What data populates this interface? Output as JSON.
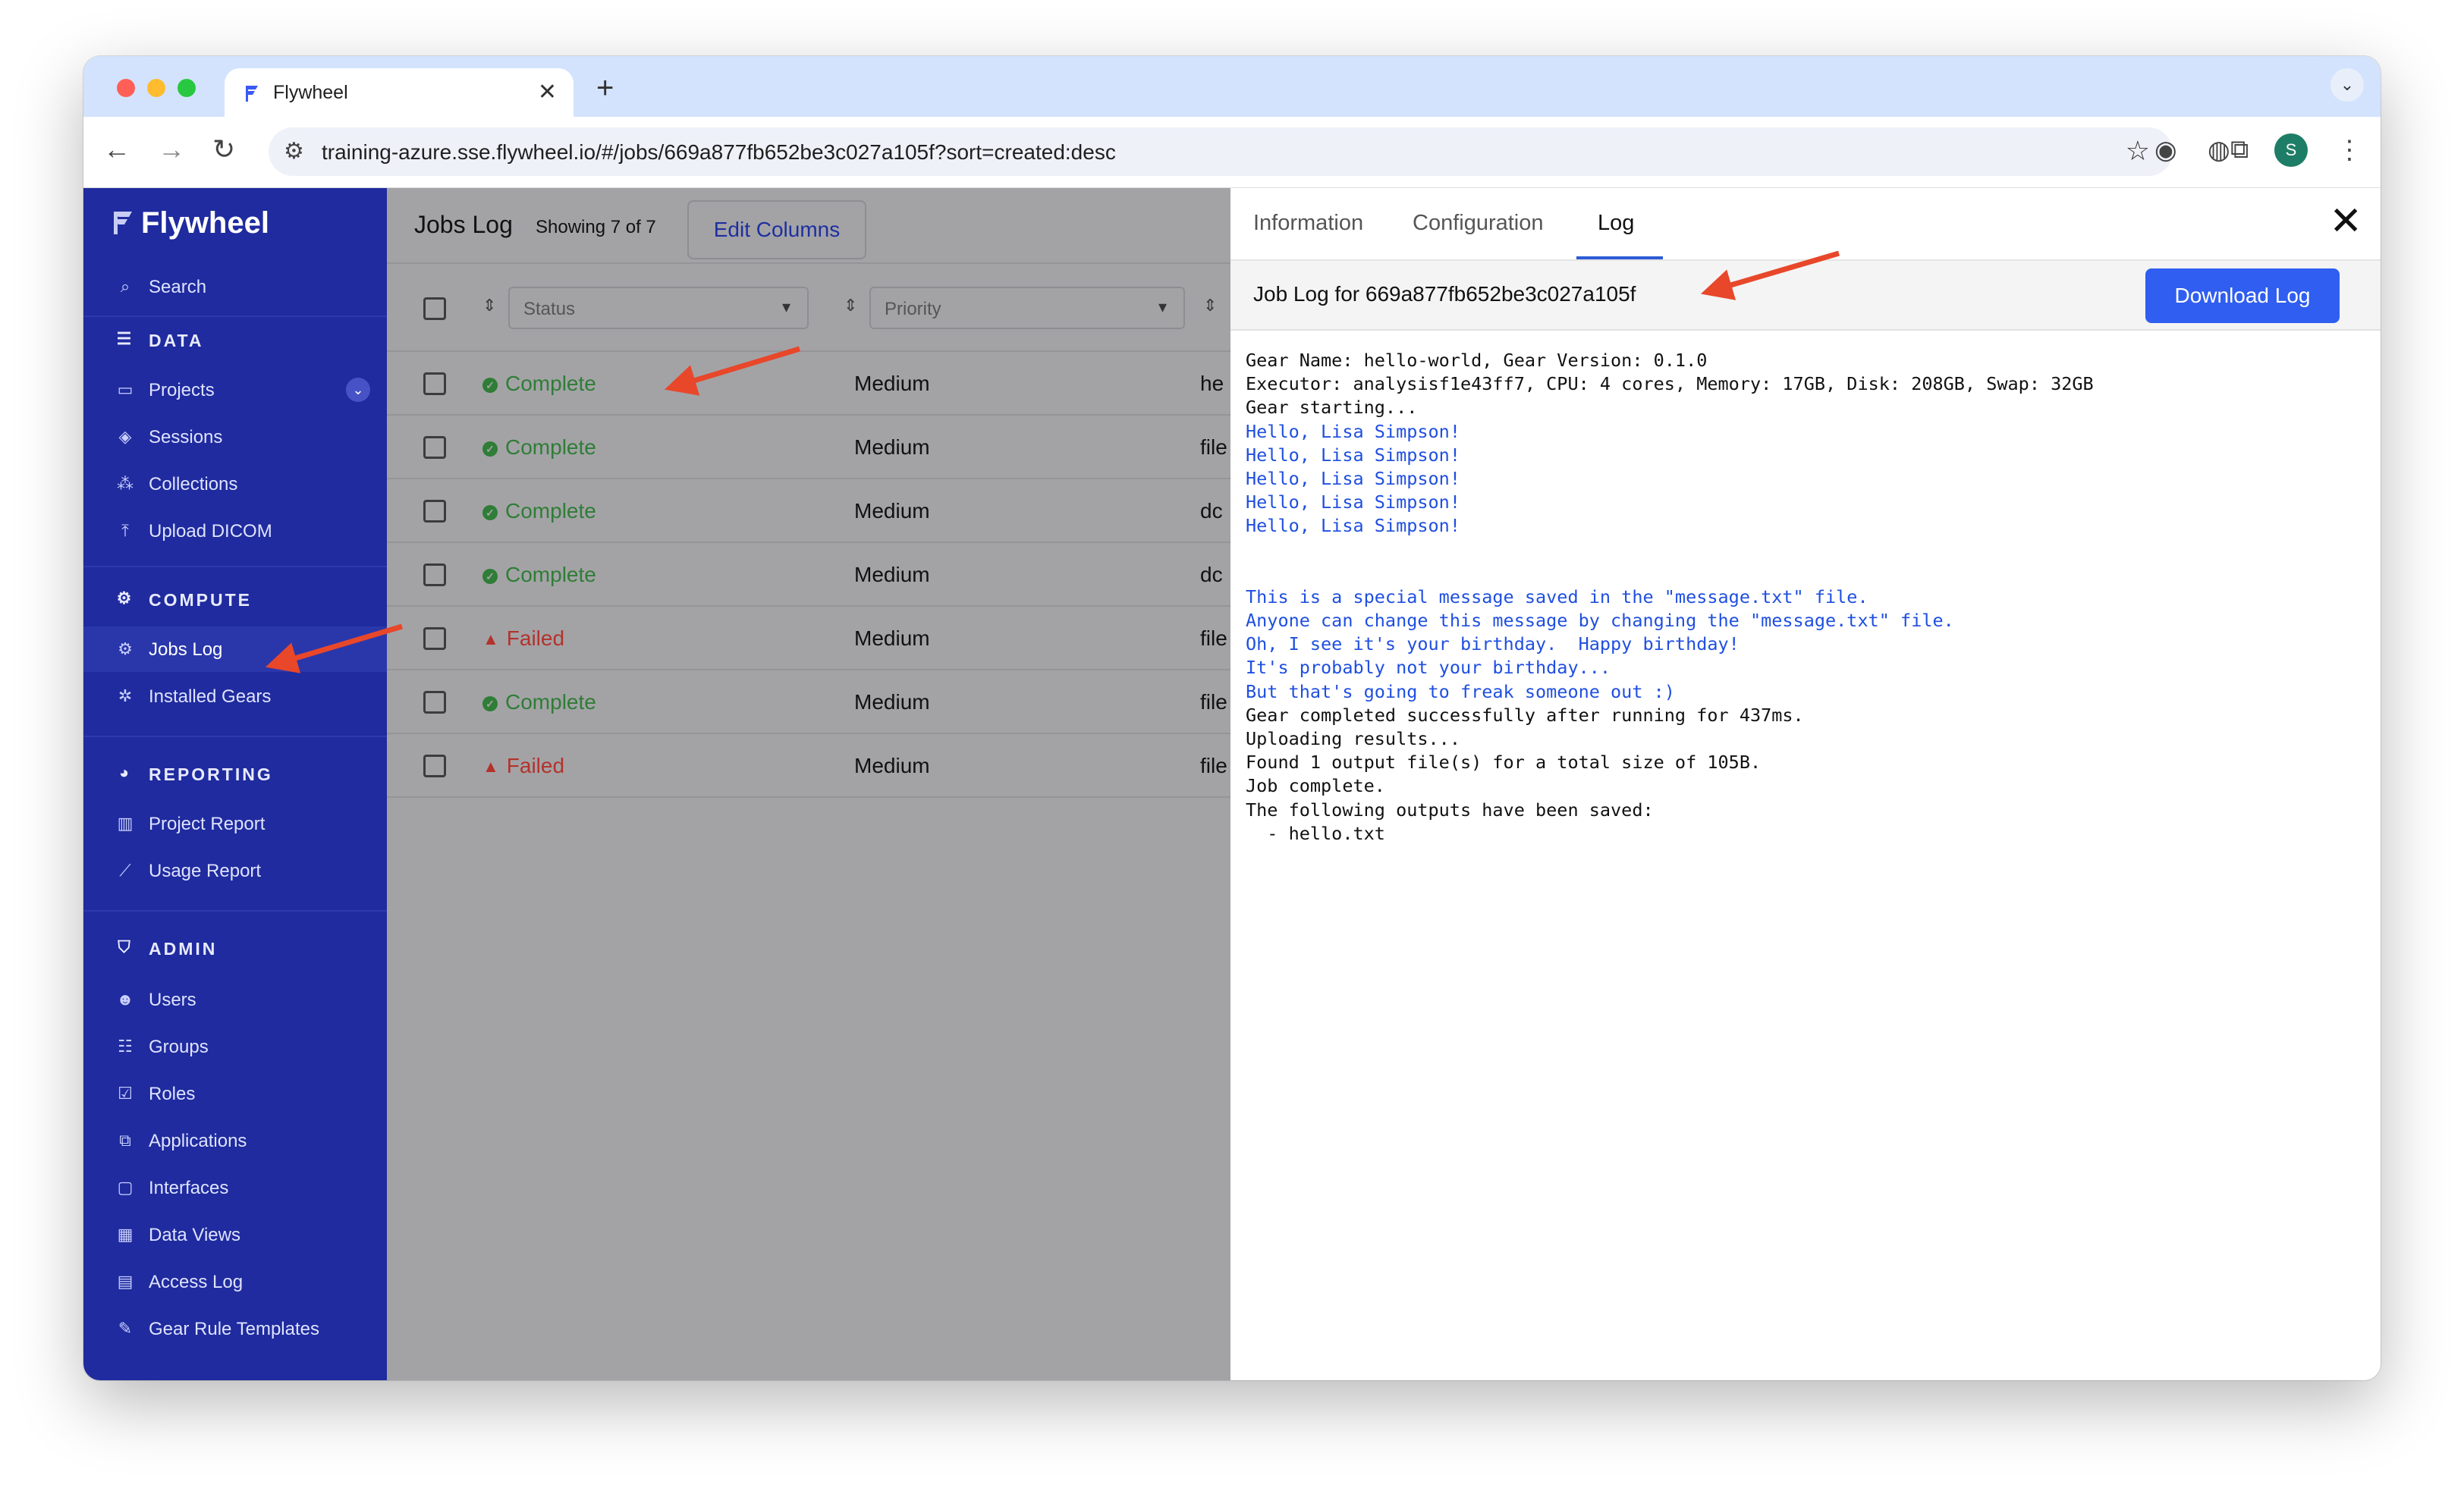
{
  "browser": {
    "tab_title": "Flywheel",
    "tab_close": "✕",
    "new_tab": "+",
    "url": "training-azure.sse.flywheel.io/#/jobs/669a877fb652be3c027a105f?sort=created:desc",
    "avatar_initial": "S",
    "icons": [
      "back-icon",
      "forward-icon",
      "reload-icon",
      "site-settings-icon",
      "bookmark-star-icon",
      "extension-icon",
      "puzzle-icon",
      "menu-icon"
    ]
  },
  "sidebar": {
    "brand": "Flywheel",
    "search": "Search",
    "sections": {
      "data": "DATA",
      "compute": "COMPUTE",
      "reporting": "REPORTING",
      "admin": "ADMIN"
    },
    "data_items": [
      "Projects",
      "Sessions",
      "Collections",
      "Upload DICOM"
    ],
    "compute_items": [
      "Jobs Log",
      "Installed Gears"
    ],
    "reporting_items": [
      "Project Report",
      "Usage Report"
    ],
    "admin_items": [
      "Users",
      "Groups",
      "Roles",
      "Applications",
      "Interfaces",
      "Data Views",
      "Access Log",
      "Gear Rule Templates"
    ]
  },
  "jobs": {
    "title": "Jobs Log",
    "count": "Showing 7 of 7",
    "edit_columns": "Edit Columns",
    "status_placeholder": "Status",
    "priority_placeholder": "Priority",
    "rows": [
      {
        "status": "Complete",
        "priority": "Medium",
        "trunc": "he"
      },
      {
        "status": "Complete",
        "priority": "Medium",
        "trunc": "file"
      },
      {
        "status": "Complete",
        "priority": "Medium",
        "trunc": "dc"
      },
      {
        "status": "Complete",
        "priority": "Medium",
        "trunc": "dc"
      },
      {
        "status": "Failed",
        "priority": "Medium",
        "trunc": "file"
      },
      {
        "status": "Complete",
        "priority": "Medium",
        "trunc": "file"
      },
      {
        "status": "Failed",
        "priority": "Medium",
        "trunc": "file"
      }
    ]
  },
  "panel": {
    "tabs": [
      "Information",
      "Configuration",
      "Log"
    ],
    "active_tab": "Log",
    "close": "✕",
    "log_title": "Job Log for 669a877fb652be3c027a105f",
    "download": "Download Log",
    "lines": [
      {
        "t": "Gear Name: hello-world, Gear Version: 0.1.0",
        "k": "sys"
      },
      {
        "t": "Executor: analysisf1e43ff7, CPU: 4 cores, Memory: 17GB, Disk: 208GB, Swap: 32GB",
        "k": "sys"
      },
      {
        "t": "Gear starting...",
        "k": "sys"
      },
      {
        "t": "Hello, Lisa Simpson!",
        "k": "stdout"
      },
      {
        "t": "Hello, Lisa Simpson!",
        "k": "stdout"
      },
      {
        "t": "Hello, Lisa Simpson!",
        "k": "stdout"
      },
      {
        "t": "Hello, Lisa Simpson!",
        "k": "stdout"
      },
      {
        "t": "Hello, Lisa Simpson!",
        "k": "stdout"
      },
      {
        "t": "",
        "k": "stdout"
      },
      {
        "t": "",
        "k": "stdout"
      },
      {
        "t": "This is a special message saved in the \"message.txt\" file.",
        "k": "stdout"
      },
      {
        "t": "Anyone can change this message by changing the \"message.txt\" file.",
        "k": "stdout"
      },
      {
        "t": "Oh, I see it's your birthday.  Happy birthday!",
        "k": "stdout"
      },
      {
        "t": "It's probably not your birthday...",
        "k": "stdout"
      },
      {
        "t": "But that's going to freak someone out :)",
        "k": "stdout"
      },
      {
        "t": "Gear completed successfully after running for 437ms.",
        "k": "sys"
      },
      {
        "t": "Uploading results...",
        "k": "sys"
      },
      {
        "t": "Found 1 output file(s) for a total size of 105B.",
        "k": "sys"
      },
      {
        "t": "Job complete.",
        "k": "sys"
      },
      {
        "t": "The following outputs have been saved:",
        "k": "sys"
      },
      {
        "t": "  - hello.txt",
        "k": "sys"
      }
    ]
  },
  "colors": {
    "sidebar": "#1f2b9e",
    "accent_button": "#2f5ef0",
    "stdout_text": "#1f4fe0",
    "complete": "#2f7d36",
    "failed": "#b3332b",
    "annotation_arrow": "#e8472a"
  }
}
